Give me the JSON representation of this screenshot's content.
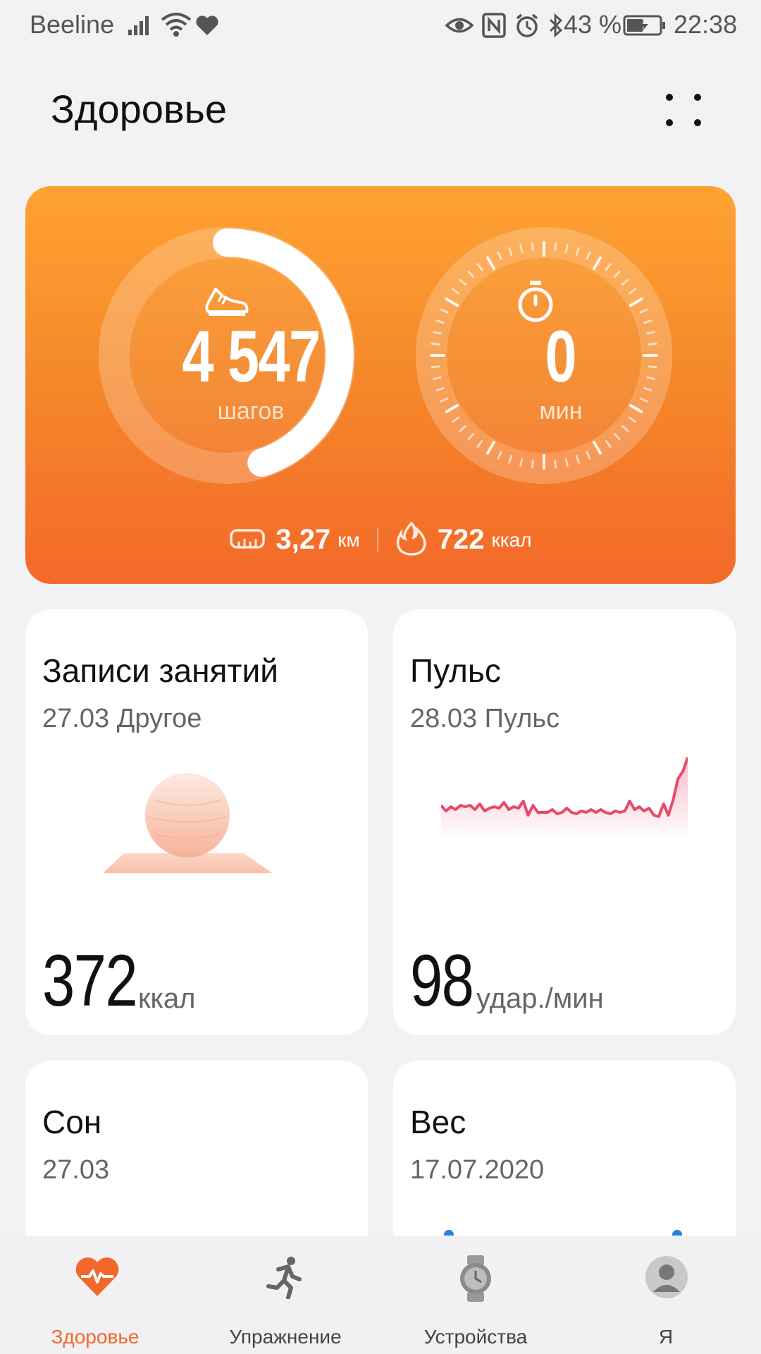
{
  "status_bar": {
    "carrier": "Beeline",
    "battery_percent": "43 %",
    "time": "22:38"
  },
  "header": {
    "title": "Здоровье"
  },
  "activity": {
    "steps_value": "4 547",
    "steps_unit": "шагов",
    "steps_progress": 0.45,
    "minutes_value": "0",
    "minutes_unit": "мин",
    "distance_value": "3,27",
    "distance_unit": "км",
    "calories_value": "722",
    "calories_unit": "ккал",
    "colors": {
      "top": "#ffa233",
      "bottom": "#f4692a"
    }
  },
  "tiles": {
    "workouts": {
      "title": "Записи занятий",
      "subtitle": "27.03 Другое",
      "value": "372",
      "unit": "ккал"
    },
    "pulse": {
      "title": "Пульс",
      "subtitle": "28.03 Пульс",
      "value": "98",
      "unit": "удар./мин",
      "line_color": "#e9496a"
    },
    "sleep": {
      "title": "Сон",
      "subtitle": "27.03"
    },
    "weight": {
      "title": "Вес",
      "subtitle": "17.07.2020"
    }
  },
  "tabbar": {
    "items": [
      {
        "label": "Здоровье",
        "icon": "heart-pulse-icon",
        "active": true
      },
      {
        "label": "Упражнение",
        "icon": "running-icon",
        "active": false
      },
      {
        "label": "Устройства",
        "icon": "watch-icon",
        "active": false
      },
      {
        "label": "Я",
        "icon": "profile-icon",
        "active": false
      }
    ],
    "accent": "#f4672a"
  }
}
